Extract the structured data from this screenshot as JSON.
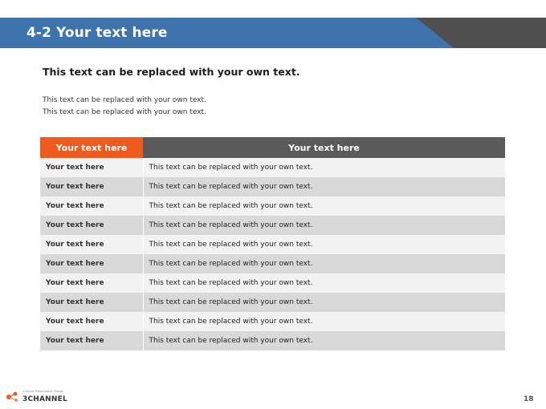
{
  "header": {
    "title": "4-2 Your text here"
  },
  "subtitle": "This text can be replaced with your own text.",
  "description": [
    "This text can be replaced with your own text.",
    "This text can be replaced with your own text."
  ],
  "table": {
    "headers": [
      "Your text here",
      "Your text here"
    ],
    "rows": [
      [
        "Your text here",
        "This text can be replaced with your own text."
      ],
      [
        "Your text here",
        "This text can be replaced with your own text."
      ],
      [
        "Your text here",
        "This text can be replaced with your own text."
      ],
      [
        "Your text here",
        "This text can be replaced with your own text."
      ],
      [
        "Your text here",
        "This text can be replaced with your own text."
      ],
      [
        "Your text here",
        "This text can be replaced with your own text."
      ],
      [
        "Your text here",
        "This text can be replaced with your own text."
      ],
      [
        "Your text here",
        "This text can be replaced with your own text."
      ],
      [
        "Your text here",
        "This text can be replaced with your own text."
      ],
      [
        "Your text here",
        "This text can be replaced with your own text."
      ]
    ]
  },
  "footer": {
    "logo_text": "3CHANNEL",
    "logo_tagline": "Creative Presentation Design",
    "page_number": "18"
  },
  "colors": {
    "header_blue": "#3f73ac",
    "header_gray": "#4f4f4f",
    "accent_orange": "#ef5a1f",
    "table_header_gray": "#5a5a5a"
  }
}
